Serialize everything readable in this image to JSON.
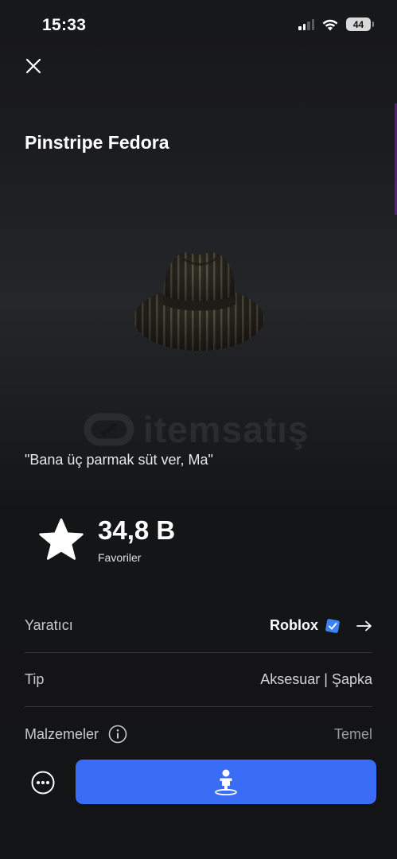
{
  "status_bar": {
    "time": "15:33",
    "battery": "44"
  },
  "item": {
    "title": "Pinstripe Fedora",
    "description": "\"Bana üç parmak süt ver, Ma\"",
    "favorites_count": "34,8 B",
    "favorites_label": "Favoriler"
  },
  "watermark": {
    "text": "itemsatış"
  },
  "details": {
    "creator_label": "Yaratıcı",
    "creator_value": "Roblox",
    "type_label": "Tip",
    "type_value": "Aksesuar | Şapka",
    "materials_label": "Malzemeler",
    "materials_value": "Temel"
  },
  "colors": {
    "background": "#131416",
    "accent_button": "#3b6cf6",
    "verified_badge": "#3b82f6"
  },
  "icons": {
    "close": "close-icon",
    "star": "star-icon",
    "verified": "verified-badge-icon",
    "arrow": "arrow-right-icon",
    "info": "info-icon",
    "more": "more-options-icon",
    "avatar": "avatar-try-on-icon"
  }
}
